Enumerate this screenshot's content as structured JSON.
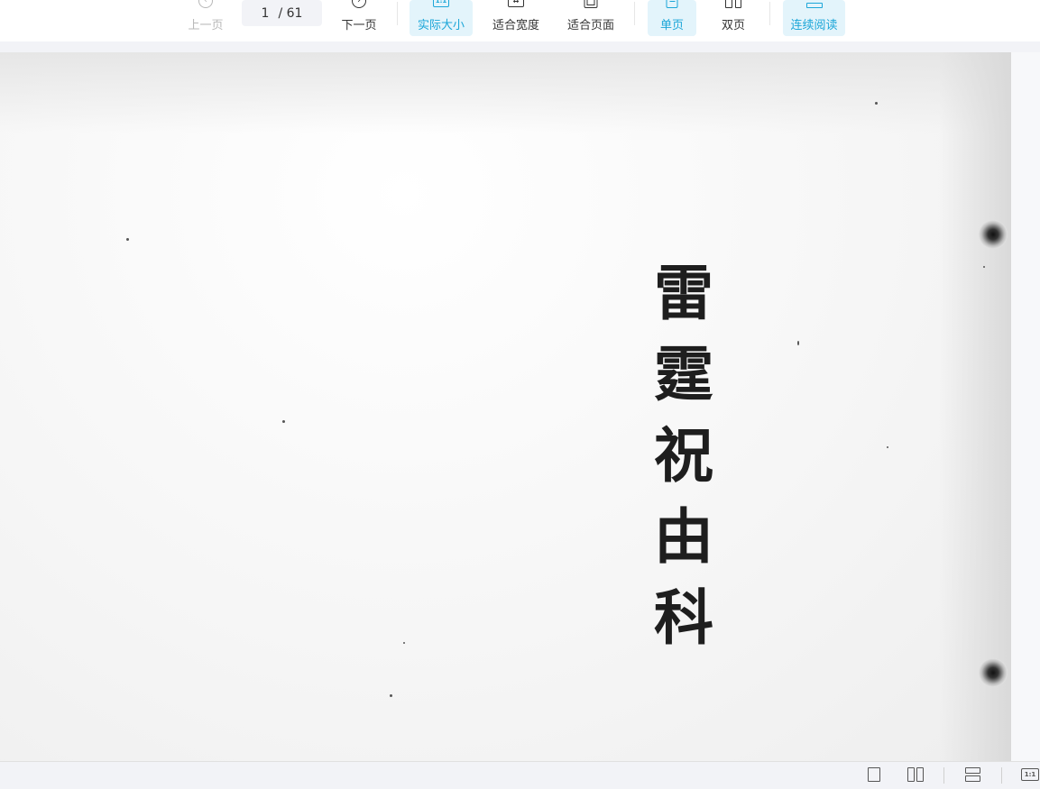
{
  "toolbar": {
    "prev_label": "上一页",
    "page_current": "1",
    "page_total": "/ 61",
    "next_label": "下一页",
    "actual_size_label": "实际大小",
    "actual_size_icon_text": "1:1",
    "fit_width_label": "适合宽度",
    "fit_page_label": "适合页面",
    "single_page_label": "单页",
    "double_page_label": "双页",
    "continuous_label": "连续阅读",
    "accent_color": "#1ca6d8"
  },
  "document": {
    "title_chars": [
      "雷",
      "霆",
      "祝",
      "由",
      "科"
    ]
  },
  "statusbar": {
    "actual_size_icon_text": "1:1"
  }
}
